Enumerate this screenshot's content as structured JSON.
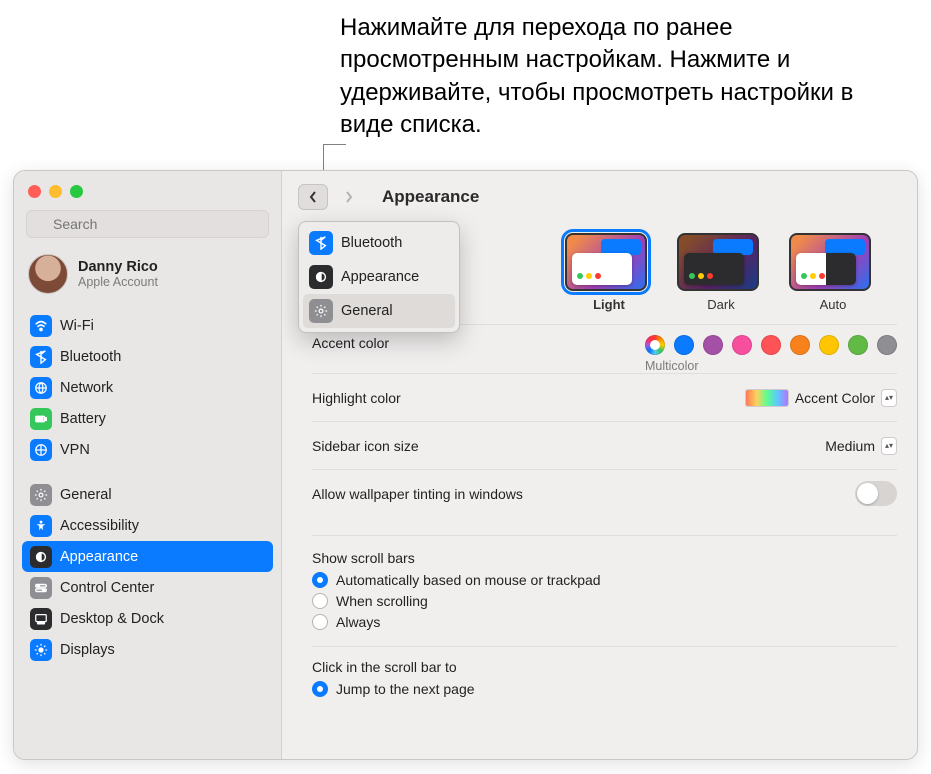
{
  "callout": "Нажимайте для перехода по ранее просмотренным настройкам. Нажмите и удерживайте, чтобы просмотреть настройки в виде списка.",
  "search": {
    "placeholder": "Search"
  },
  "account": {
    "name": "Danny Rico",
    "sub": "Apple Account"
  },
  "sidebar": {
    "group1": [
      {
        "label": "Wi-Fi"
      },
      {
        "label": "Bluetooth"
      },
      {
        "label": "Network"
      },
      {
        "label": "Battery"
      },
      {
        "label": "VPN"
      }
    ],
    "group2": [
      {
        "label": "General"
      },
      {
        "label": "Accessibility"
      },
      {
        "label": "Appearance"
      },
      {
        "label": "Control Center"
      },
      {
        "label": "Desktop & Dock"
      },
      {
        "label": "Displays"
      }
    ]
  },
  "page": {
    "title": "Appearance"
  },
  "popover": {
    "items": [
      {
        "label": "Bluetooth"
      },
      {
        "label": "Appearance"
      },
      {
        "label": "General"
      }
    ]
  },
  "appearanceModes": {
    "options": [
      {
        "label": "Light"
      },
      {
        "label": "Dark"
      },
      {
        "label": "Auto"
      }
    ]
  },
  "accent": {
    "label": "Accent color",
    "selected_name": "Multicolor",
    "colors": [
      "multi",
      "#0a7bff",
      "#a550a7",
      "#f74f9e",
      "#ff5257",
      "#f7821b",
      "#ffc600",
      "#62ba46",
      "#8e8e93"
    ]
  },
  "highlight": {
    "label": "Highlight color",
    "value": "Accent Color"
  },
  "sidebarIcon": {
    "label": "Sidebar icon size",
    "value": "Medium"
  },
  "tinting": {
    "label": "Allow wallpaper tinting in windows",
    "on": false
  },
  "scrollBars": {
    "title": "Show scroll bars",
    "options": [
      "Automatically based on mouse or trackpad",
      "When scrolling",
      "Always"
    ],
    "selected": 0
  },
  "scrollClick": {
    "title": "Click in the scroll bar to",
    "options": [
      "Jump to the next page"
    ],
    "selected": 0
  }
}
